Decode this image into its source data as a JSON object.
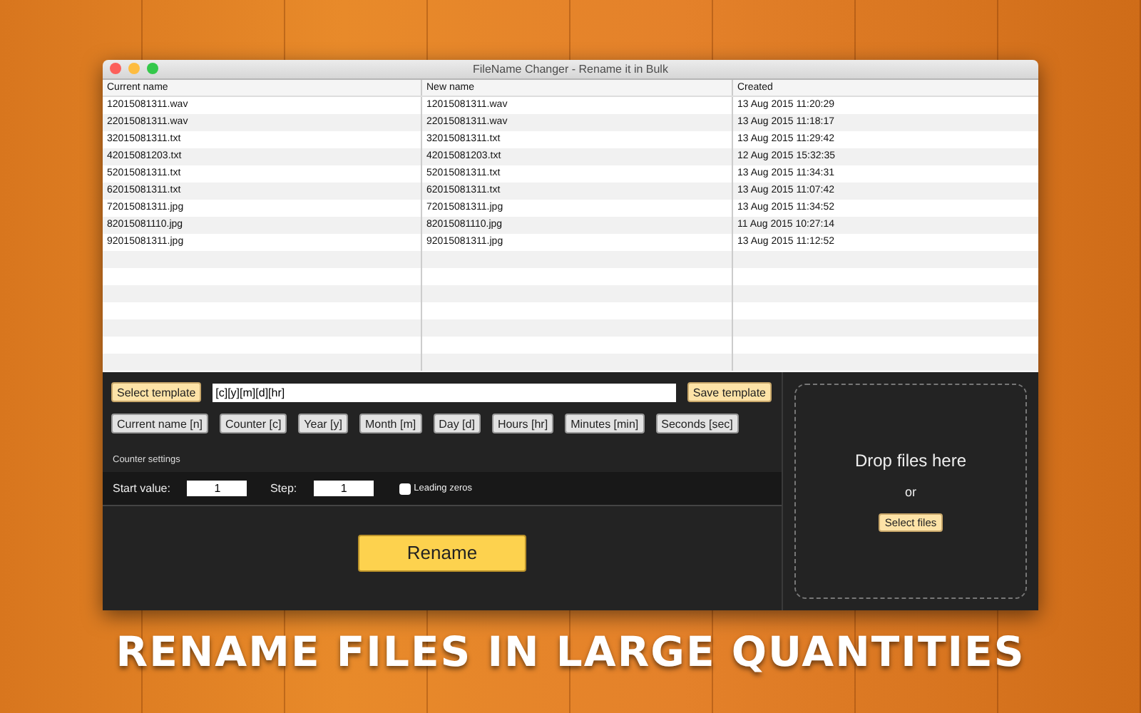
{
  "window": {
    "title": "FileName Changer - Rename it in Bulk"
  },
  "table": {
    "columns": [
      "Current name",
      "New name",
      "Created"
    ],
    "rows": [
      [
        "12015081311.wav",
        "12015081311.wav",
        "13 Aug 2015 11:20:29"
      ],
      [
        "22015081311.wav",
        "22015081311.wav",
        "13 Aug 2015 11:18:17"
      ],
      [
        "32015081311.txt",
        "32015081311.txt",
        "13 Aug 2015 11:29:42"
      ],
      [
        "42015081203.txt",
        "42015081203.txt",
        "12 Aug 2015 15:32:35"
      ],
      [
        "52015081311.txt",
        "52015081311.txt",
        "13 Aug 2015 11:34:31"
      ],
      [
        "62015081311.txt",
        "62015081311.txt",
        "13 Aug 2015 11:07:42"
      ],
      [
        "72015081311.jpg",
        "72015081311.jpg",
        "13 Aug 2015 11:34:52"
      ],
      [
        "82015081110.jpg",
        "82015081110.jpg",
        "11 Aug 2015 10:27:14"
      ],
      [
        "92015081311.jpg",
        "92015081311.jpg",
        "13 Aug 2015 11:12:52"
      ]
    ]
  },
  "template": {
    "select_button": "Select template",
    "value": "[c][y][m][d][hr]",
    "save_button": "Save template"
  },
  "tokens": [
    "Current name [n]",
    "Counter [c]",
    "Year [y]",
    "Month [m]",
    "Day [d]",
    "Hours [hr]",
    "Minutes [min]",
    "Seconds [sec]"
  ],
  "counter_settings": {
    "title": "Counter settings",
    "start_label": "Start value:",
    "start_value": "1",
    "step_label": "Step:",
    "step_value": "1",
    "leading_zeros": {
      "label": "Leading zeros",
      "checked": false
    }
  },
  "rename_button": "Rename",
  "drop_zone": {
    "title": "Drop files here",
    "or": "or",
    "button": "Select files"
  },
  "caption": "RENAME FILES IN LARGE QUANTITIES"
}
